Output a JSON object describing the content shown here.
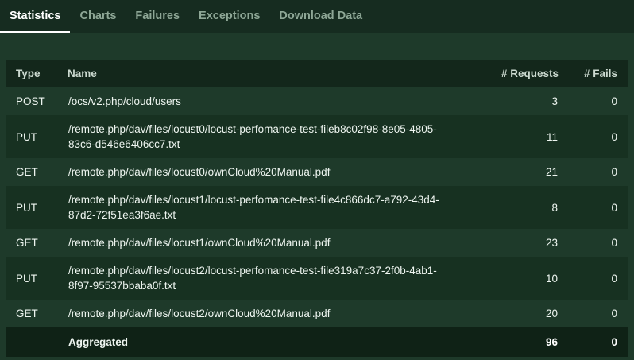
{
  "nav": {
    "tabs": [
      {
        "label": "Statistics",
        "active": true
      },
      {
        "label": "Charts",
        "active": false
      },
      {
        "label": "Failures",
        "active": false
      },
      {
        "label": "Exceptions",
        "active": false
      },
      {
        "label": "Download Data",
        "active": false
      }
    ]
  },
  "table": {
    "columns": [
      "Type",
      "Name",
      "# Requests",
      "# Fails"
    ],
    "rows": [
      {
        "type": "POST",
        "name": "/ocs/v2.php/cloud/users",
        "requests": "3",
        "fails": "0"
      },
      {
        "type": "PUT",
        "name": "/remote.php/dav/files/locust0/locust-perfomance-test-fileb8c02f98-8e05-4805-83c6-d546e6406cc7.txt",
        "requests": "11",
        "fails": "0"
      },
      {
        "type": "GET",
        "name": "/remote.php/dav/files/locust0/ownCloud%20Manual.pdf",
        "requests": "21",
        "fails": "0"
      },
      {
        "type": "PUT",
        "name": "/remote.php/dav/files/locust1/locust-perfomance-test-file4c866dc7-a792-43d4-87d2-72f51ea3f6ae.txt",
        "requests": "8",
        "fails": "0"
      },
      {
        "type": "GET",
        "name": "/remote.php/dav/files/locust1/ownCloud%20Manual.pdf",
        "requests": "23",
        "fails": "0"
      },
      {
        "type": "PUT",
        "name": "/remote.php/dav/files/locust2/locust-perfomance-test-file319a7c37-2f0b-4ab1-8f97-95537bbaba0f.txt",
        "requests": "10",
        "fails": "0"
      },
      {
        "type": "GET",
        "name": "/remote.php/dav/files/locust2/ownCloud%20Manual.pdf",
        "requests": "20",
        "fails": "0"
      }
    ],
    "aggregated": {
      "type": "",
      "name": "Aggregated",
      "requests": "96",
      "fails": "0"
    }
  },
  "colors": {
    "page_bg": "#1e3a2a",
    "nav_bg": "#162c20",
    "header_bg": "#13271b",
    "row_odd": "#1e3a2a",
    "row_even": "#173121",
    "agg_bg": "#0f2216",
    "active_tab": "#ffffff",
    "inactive_tab": "#8ea796",
    "header_text": "#ccdad0",
    "cell_text": "#eef5f0"
  }
}
